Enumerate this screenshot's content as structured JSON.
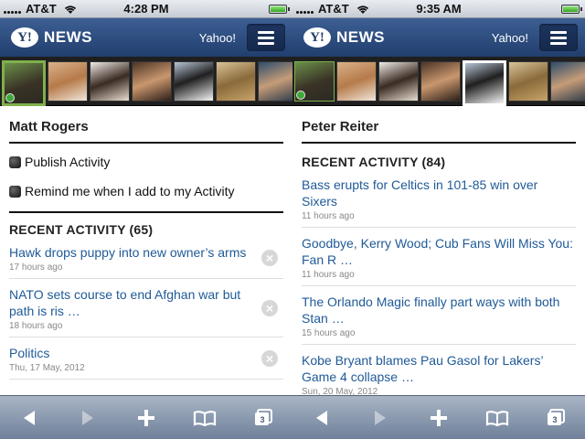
{
  "screens": [
    {
      "status": {
        "carrier": "AT&T",
        "time": "4:28 PM"
      },
      "header": {
        "logo_letter": "Y!",
        "title": "NEWS",
        "link": "Yahoo!"
      },
      "profile_name": "Matt Rogers",
      "options": [
        {
          "label": "Publish Activity"
        },
        {
          "label": "Remind me when I add to my Activity"
        }
      ],
      "recent_title": "RECENT ACTIVITY (65)",
      "items": [
        {
          "title": "Hawk drops puppy into new owner’s arms",
          "time": "17 hours ago"
        },
        {
          "title": "NATO sets course to end Afghan war but path is ris …",
          "time": "18 hours ago"
        },
        {
          "title": "Politics",
          "time": "Thu, 17 May, 2012"
        }
      ],
      "toolbar": {
        "pages_count": "3"
      }
    },
    {
      "status": {
        "carrier": "AT&T",
        "time": "9:35 AM"
      },
      "header": {
        "logo_letter": "Y!",
        "title": "NEWS",
        "link": "Yahoo!"
      },
      "profile_name": "Peter Reiter",
      "recent_title": "RECENT ACTIVITY (84)",
      "items": [
        {
          "title": "Bass erupts for Celtics in 101-85 win over Sixers",
          "time": "11 hours ago"
        },
        {
          "title": "Goodbye, Kerry Wood; Cub Fans Will Miss You: Fan R …",
          "time": "11 hours ago"
        },
        {
          "title": "The Orlando Magic finally part ways with both Stan …",
          "time": "15 hours ago"
        },
        {
          "title": "Kobe Bryant blames Pau Gasol for Lakers’ Game 4 collapse …",
          "time": "Sun, 20 May, 2012"
        }
      ],
      "toolbar": {
        "pages_count": "3"
      }
    }
  ],
  "colors": {
    "header": "#2c4a7c",
    "link": "#1f5a97",
    "strip": "#1f1f1f",
    "online": "#3fa83a"
  },
  "icons": [
    "wifi-icon",
    "battery-icon",
    "menu-icon",
    "back-icon",
    "forward-icon",
    "add-icon",
    "bookmarks-icon",
    "pages-icon",
    "remove-icon"
  ]
}
